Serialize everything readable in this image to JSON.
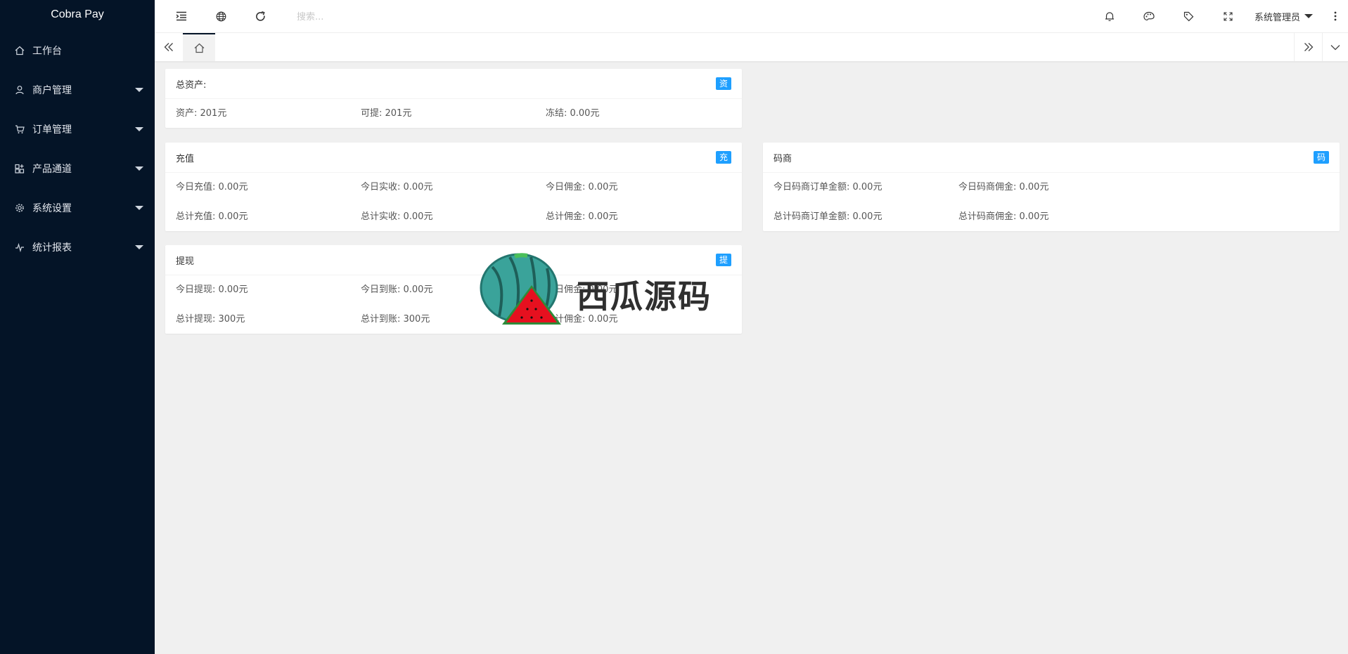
{
  "app": {
    "brand": "Cobra Pay"
  },
  "sidebar": {
    "items": [
      {
        "label": "工作台",
        "icon": "home-icon",
        "has_submenu": false
      },
      {
        "label": "商户管理",
        "icon": "user-icon",
        "has_submenu": true
      },
      {
        "label": "订单管理",
        "icon": "cart-icon",
        "has_submenu": true
      },
      {
        "label": "产品通道",
        "icon": "apps-add-icon",
        "has_submenu": true
      },
      {
        "label": "系统设置",
        "icon": "gear-icon",
        "has_submenu": true
      },
      {
        "label": "统计报表",
        "icon": "pulse-icon",
        "has_submenu": true
      }
    ]
  },
  "header": {
    "search_placeholder": "搜索...",
    "user_name": "系统管理员",
    "icons": [
      "menu-fold-icon",
      "globe-icon",
      "refresh-icon",
      "bell-icon",
      "palette-icon",
      "tag-icon",
      "fullscreen-icon",
      "more-vertical-icon"
    ]
  },
  "tabs": {
    "home_icon": "home-icon"
  },
  "cards": {
    "assets": {
      "title": "总资产:",
      "badge": "资",
      "row1": [
        "资产: 201元",
        "可提: 201元",
        "冻结: 0.00元"
      ]
    },
    "recharge": {
      "title": "充值",
      "badge": "充",
      "row1": [
        "今日充值: 0.00元",
        "今日实收: 0.00元",
        "今日佣金: 0.00元"
      ],
      "row2": [
        "总计充值: 0.00元",
        "总计实收: 0.00元",
        "总计佣金: 0.00元"
      ]
    },
    "coder": {
      "title": "码商",
      "badge": "码",
      "row1": [
        "今日码商订单金额: 0.00元",
        "今日码商佣金: 0.00元"
      ],
      "row2": [
        "总计码商订单金额: 0.00元",
        "总计码商佣金: 0.00元"
      ]
    },
    "withdraw": {
      "title": "提现",
      "badge": "提",
      "row1": [
        "今日提现: 0.00元",
        "今日到账: 0.00元",
        "今日佣金: 0.00元"
      ],
      "row2": [
        "总计提现: 300元",
        "总计到账: 300元",
        "总计佣金: 0.00元"
      ]
    }
  },
  "watermark": {
    "text": "西瓜源码"
  },
  "colors": {
    "sidebar_bg": "#041427",
    "badge": "#1e9fff",
    "page_bg": "#f0f0f0"
  }
}
